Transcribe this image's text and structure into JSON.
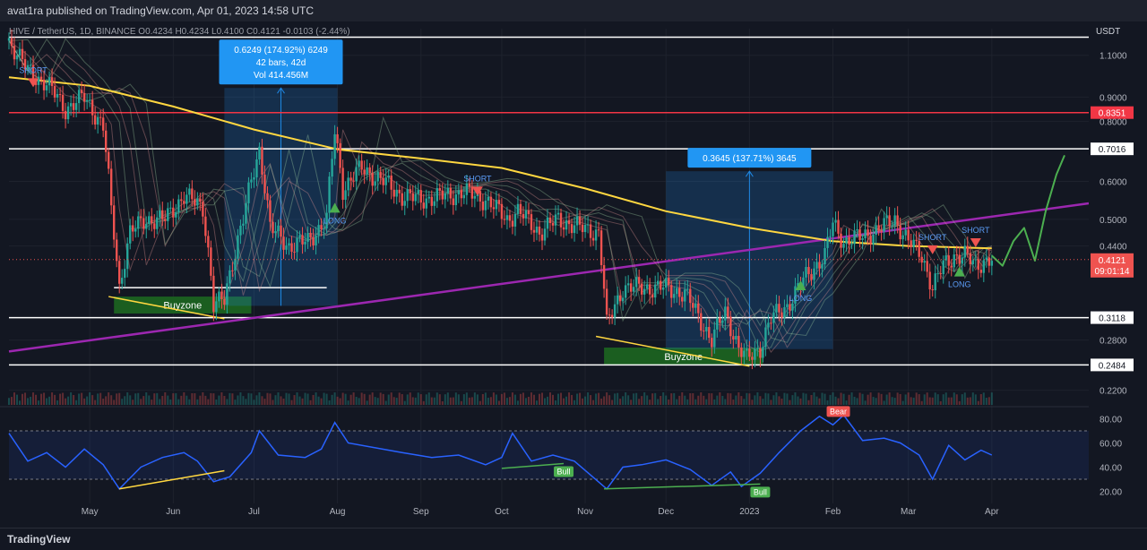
{
  "header": {
    "published": "avat1ra published on TradingView.com, Apr 01, 2023 14:58 UTC"
  },
  "symbol_line": "HIVE / TetherUS, 1D, BINANCE  O0.4234  H0.4234  L0.4100  C0.4121  -0.0103 (-2.44%)",
  "footer": {
    "brand": "TradingView"
  },
  "colors": {
    "background": "#131722",
    "grid": "#1e222d",
    "price_line": "#ffd740",
    "trend_line": "#9c27b0",
    "resistance": "#f23645",
    "support": "#ffffff",
    "rsi": "#2962ff",
    "up": "#26a69a",
    "down": "#ef5350",
    "buyzone": "#1b5e20",
    "measure": "#1e88e5"
  },
  "chart_data": [
    {
      "type": "candlestick",
      "symbol": "HIVE / TetherUS",
      "interval": "1D",
      "exchange": "BINANCE",
      "ohlc_last": {
        "open": 0.4234,
        "high": 0.4234,
        "low": 0.41,
        "close": 0.4121,
        "change": -0.0103,
        "change_pct": -2.44
      },
      "y_scale": "log",
      "y_unit": "USDT",
      "ylim": [
        0.205,
        1.25
      ],
      "y_ticks": [
        1.1,
        0.9,
        0.8,
        0.6,
        0.5,
        0.44,
        0.28,
        0.22
      ],
      "y_tick_labels": [
        "1.1000",
        "0.9000",
        "0.8000",
        "0.6000",
        "0.5000",
        "0.4400",
        "0.2800",
        "0.2200"
      ],
      "x_ticks": [
        "May",
        "Jun",
        "Jul",
        "Aug",
        "Sep",
        "Oct",
        "Nov",
        "Dec",
        "2023",
        "Feb",
        "Mar",
        "Apr"
      ],
      "xlim": [
        "2022-04-01",
        "2023-05-07"
      ],
      "price_path": [
        [
          "2022-04-01",
          1.18
        ],
        [
          "2022-04-08",
          1.02
        ],
        [
          "2022-04-15",
          0.96
        ],
        [
          "2022-04-22",
          0.85
        ],
        [
          "2022-04-29",
          0.9
        ],
        [
          "2022-05-06",
          0.78
        ],
        [
          "2022-05-09",
          0.52
        ],
        [
          "2022-05-12",
          0.36
        ],
        [
          "2022-05-16",
          0.47
        ],
        [
          "2022-05-22",
          0.5
        ],
        [
          "2022-05-29",
          0.5
        ],
        [
          "2022-06-05",
          0.56
        ],
        [
          "2022-06-12",
          0.53
        ],
        [
          "2022-06-16",
          0.33
        ],
        [
          "2022-06-20",
          0.34
        ],
        [
          "2022-06-27",
          0.5
        ],
        [
          "2022-07-03",
          0.7
        ],
        [
          "2022-07-07",
          0.48
        ],
        [
          "2022-07-14",
          0.44
        ],
        [
          "2022-07-21",
          0.45
        ],
        [
          "2022-07-28",
          0.5
        ],
        [
          "2022-07-31",
          0.76
        ],
        [
          "2022-08-03",
          0.58
        ],
        [
          "2022-08-10",
          0.64
        ],
        [
          "2022-08-18",
          0.6
        ],
        [
          "2022-08-25",
          0.56
        ],
        [
          "2022-09-01",
          0.55
        ],
        [
          "2022-09-10",
          0.56
        ],
        [
          "2022-09-17",
          0.57
        ],
        [
          "2022-09-25",
          0.55
        ],
        [
          "2022-10-03",
          0.5
        ],
        [
          "2022-10-07",
          0.52
        ],
        [
          "2022-10-15",
          0.47
        ],
        [
          "2022-10-22",
          0.5
        ],
        [
          "2022-10-30",
          0.48
        ],
        [
          "2022-11-06",
          0.47
        ],
        [
          "2022-11-09",
          0.3
        ],
        [
          "2022-11-15",
          0.36
        ],
        [
          "2022-11-22",
          0.36
        ],
        [
          "2022-12-01",
          0.36
        ],
        [
          "2022-12-08",
          0.35
        ],
        [
          "2022-12-15",
          0.3
        ],
        [
          "2022-12-18",
          0.28
        ],
        [
          "2022-12-23",
          0.32
        ],
        [
          "2022-12-28",
          0.27
        ],
        [
          "2022-12-31",
          0.255
        ],
        [
          "2023-01-05",
          0.27
        ],
        [
          "2023-01-09",
          0.31
        ],
        [
          "2023-01-15",
          0.33
        ],
        [
          "2023-01-22",
          0.38
        ],
        [
          "2023-01-29",
          0.42
        ],
        [
          "2023-02-01",
          0.49
        ],
        [
          "2023-02-05",
          0.45
        ],
        [
          "2023-02-12",
          0.46
        ],
        [
          "2023-02-19",
          0.48
        ],
        [
          "2023-02-24",
          0.5
        ],
        [
          "2023-03-01",
          0.45
        ],
        [
          "2023-03-06",
          0.42
        ],
        [
          "2023-03-10",
          0.36
        ],
        [
          "2023-03-14",
          0.4
        ],
        [
          "2023-03-18",
          0.42
        ],
        [
          "2023-03-22",
          0.42
        ],
        [
          "2023-03-26",
          0.4
        ],
        [
          "2023-03-29",
          0.41
        ],
        [
          "2023-04-01",
          0.4121
        ]
      ],
      "projection_path": [
        [
          "2023-04-01",
          0.42
        ],
        [
          "2023-04-05",
          0.4
        ],
        [
          "2023-04-09",
          0.45
        ],
        [
          "2023-04-13",
          0.48
        ],
        [
          "2023-04-17",
          0.41
        ],
        [
          "2023-04-21",
          0.52
        ],
        [
          "2023-04-25",
          0.62
        ],
        [
          "2023-04-28",
          0.68
        ]
      ],
      "ma200_path": [
        [
          "2022-04-01",
          0.99
        ],
        [
          "2022-05-01",
          0.95
        ],
        [
          "2022-06-01",
          0.86
        ],
        [
          "2022-07-01",
          0.77
        ],
        [
          "2022-08-01",
          0.7
        ],
        [
          "2022-09-01",
          0.67
        ],
        [
          "2022-10-01",
          0.64
        ],
        [
          "2022-11-01",
          0.58
        ],
        [
          "2022-12-01",
          0.52
        ],
        [
          "2023-01-01",
          0.48
        ],
        [
          "2023-02-01",
          0.45
        ],
        [
          "2023-03-01",
          0.44
        ],
        [
          "2023-04-01",
          0.435
        ]
      ],
      "horizontal_levels": [
        {
          "price": 1.2,
          "label": "",
          "color": "#ffffff"
        },
        {
          "price": 0.8351,
          "label": "0.8351",
          "color": "#f23645"
        },
        {
          "price": 0.7016,
          "label": "0.7016",
          "color": "#ffffff"
        },
        {
          "price": 0.3118,
          "label": "0.3118",
          "color": "#ffffff"
        },
        {
          "price": 0.2484,
          "label": "0.2484",
          "color": "#ffffff"
        }
      ],
      "trendline": {
        "from": [
          "2022-04-01",
          0.265
        ],
        "to": [
          "2023-05-07",
          0.54
        ]
      },
      "buyzones": [
        {
          "label": "Buyzone",
          "from": "2022-05-10",
          "to": "2022-06-30",
          "low": 0.318,
          "high": 0.345
        },
        {
          "label": "Buyzone",
          "from": "2022-11-08",
          "to": "2023-01-06",
          "low": 0.248,
          "high": 0.27
        }
      ],
      "measures": [
        {
          "label": "0.6249 (174.92%) 6249",
          "bars": "42 bars, 42d",
          "vol": "Vol 414.456M",
          "from": "2022-06-20",
          "to": "2022-08-01",
          "low": 0.33,
          "high": 0.94
        },
        {
          "label": "0.3645 (137.71%) 3645",
          "from": "2022-12-01",
          "to": "2023-02-01",
          "low": 0.268,
          "high": 0.63
        }
      ],
      "signals": [
        {
          "type": "SHORT",
          "date": "2022-04-10",
          "price": 0.96
        },
        {
          "type": "LONG",
          "date": "2022-07-31",
          "price": 0.53
        },
        {
          "type": "SHORT",
          "date": "2022-09-22",
          "price": 0.57
        },
        {
          "type": "LONG",
          "date": "2023-01-20",
          "price": 0.365
        },
        {
          "type": "SHORT",
          "date": "2023-03-10",
          "price": 0.43
        },
        {
          "type": "LONG",
          "date": "2023-03-20",
          "price": 0.39
        },
        {
          "type": "SHORT",
          "date": "2023-03-26",
          "price": 0.445
        }
      ],
      "current_price": {
        "value": "0.4121",
        "countdown": "09:01:14"
      }
    },
    {
      "type": "line",
      "name": "RSI",
      "ylim": [
        10,
        90
      ],
      "y_ticks": [
        80,
        60,
        40,
        20
      ],
      "y_tick_labels": [
        "80.00",
        "60.00",
        "40.00",
        "20.00"
      ],
      "band": [
        30,
        70
      ],
      "rsi_path": [
        [
          "2022-04-01",
          68
        ],
        [
          "2022-04-08",
          45
        ],
        [
          "2022-04-15",
          52
        ],
        [
          "2022-04-22",
          40
        ],
        [
          "2022-04-29",
          55
        ],
        [
          "2022-05-06",
          42
        ],
        [
          "2022-05-12",
          22
        ],
        [
          "2022-05-20",
          40
        ],
        [
          "2022-05-28",
          48
        ],
        [
          "2022-06-05",
          52
        ],
        [
          "2022-06-10",
          45
        ],
        [
          "2022-06-16",
          28
        ],
        [
          "2022-06-22",
          32
        ],
        [
          "2022-06-30",
          52
        ],
        [
          "2022-07-03",
          70
        ],
        [
          "2022-07-10",
          50
        ],
        [
          "2022-07-20",
          48
        ],
        [
          "2022-07-26",
          55
        ],
        [
          "2022-07-31",
          77
        ],
        [
          "2022-08-05",
          60
        ],
        [
          "2022-08-15",
          56
        ],
        [
          "2022-08-25",
          52
        ],
        [
          "2022-09-05",
          48
        ],
        [
          "2022-09-15",
          50
        ],
        [
          "2022-09-25",
          42
        ],
        [
          "2022-10-01",
          48
        ],
        [
          "2022-10-05",
          68
        ],
        [
          "2022-10-12",
          45
        ],
        [
          "2022-10-20",
          50
        ],
        [
          "2022-10-28",
          45
        ],
        [
          "2022-11-09",
          22
        ],
        [
          "2022-11-15",
          40
        ],
        [
          "2022-11-22",
          42
        ],
        [
          "2022-12-01",
          46
        ],
        [
          "2022-12-10",
          38
        ],
        [
          "2022-12-18",
          25
        ],
        [
          "2022-12-25",
          36
        ],
        [
          "2022-12-29",
          24
        ],
        [
          "2023-01-05",
          35
        ],
        [
          "2023-01-12",
          52
        ],
        [
          "2023-01-20",
          70
        ],
        [
          "2023-01-27",
          82
        ],
        [
          "2023-02-01",
          75
        ],
        [
          "2023-02-05",
          83
        ],
        [
          "2023-02-12",
          62
        ],
        [
          "2023-02-20",
          64
        ],
        [
          "2023-02-26",
          60
        ],
        [
          "2023-03-05",
          50
        ],
        [
          "2023-03-10",
          30
        ],
        [
          "2023-03-16",
          58
        ],
        [
          "2023-03-22",
          46
        ],
        [
          "2023-03-28",
          54
        ],
        [
          "2023-04-01",
          50
        ]
      ],
      "divergences": [
        {
          "from": [
            "2022-05-12",
            22
          ],
          "to": [
            "2022-06-20",
            37
          ],
          "label": ""
        },
        {
          "from": [
            "2022-10-01",
            39
          ],
          "to": [
            "2022-10-24",
            43
          ],
          "label": "Bull"
        },
        {
          "from": [
            "2022-11-08",
            22
          ],
          "to": [
            "2023-01-05",
            26
          ],
          "label": "Bull"
        }
      ],
      "marker": {
        "label": "Bear",
        "date": "2023-02-03",
        "value": 86
      }
    }
  ]
}
